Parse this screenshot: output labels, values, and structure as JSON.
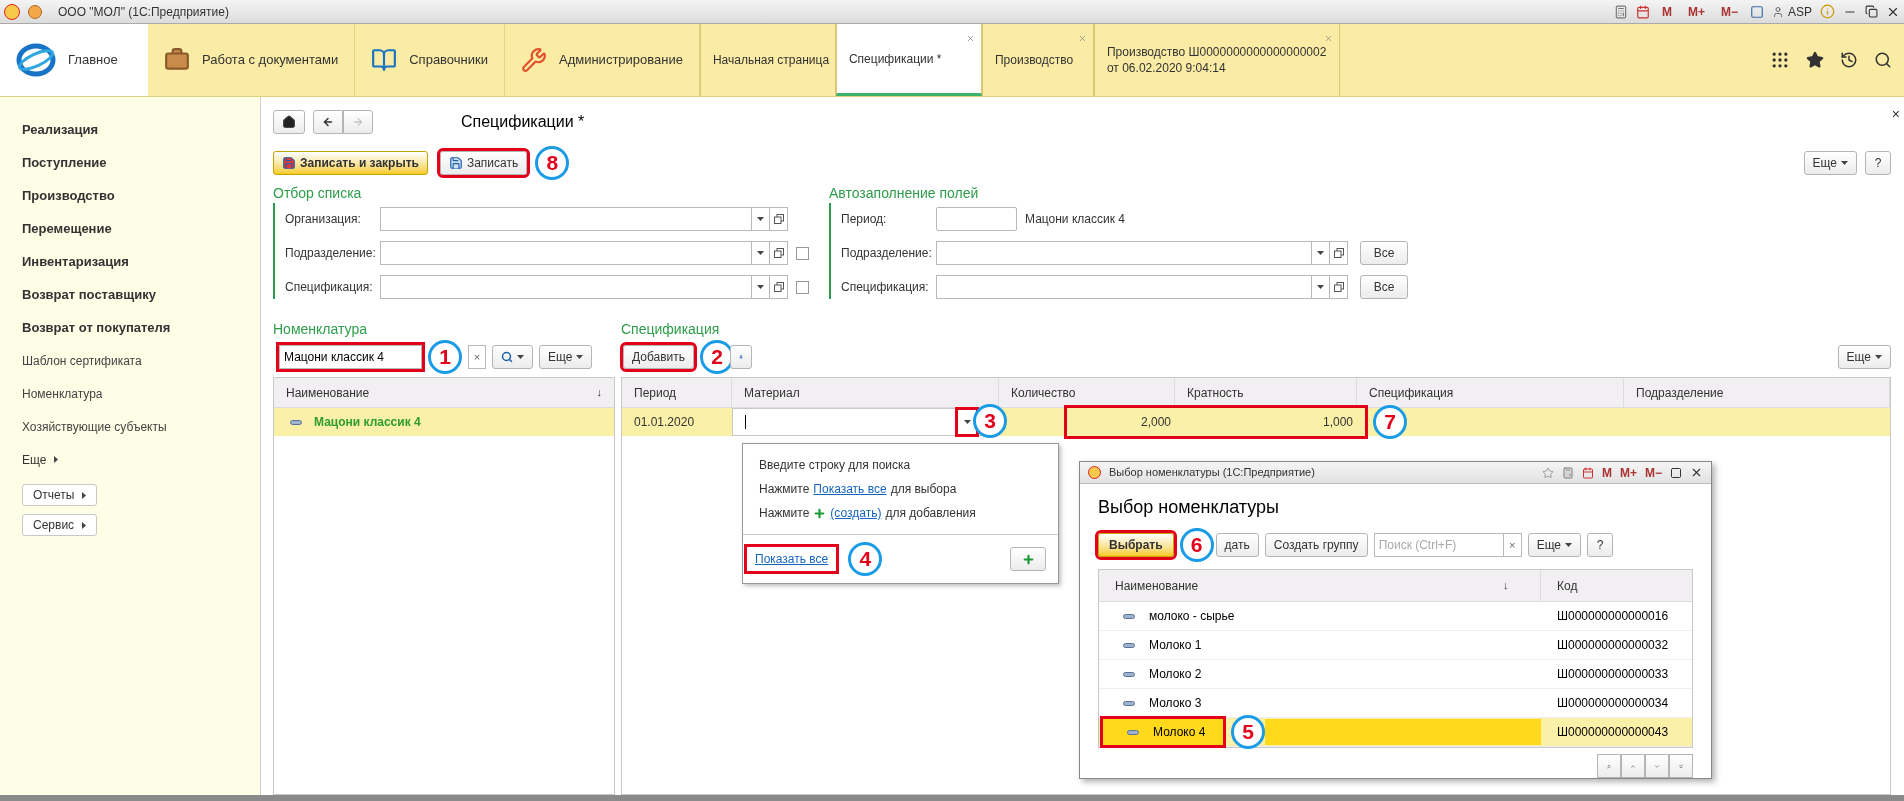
{
  "window": {
    "title": "ООО \"МОЛ\" (1С:Предприятие)",
    "memory_buttons": [
      "M",
      "M+",
      "M−"
    ],
    "user": "ASP"
  },
  "sections": [
    {
      "label": "Главное",
      "kind": "home",
      "selected": true
    },
    {
      "label": "Работа с документами",
      "kind": "briefcase",
      "selected": false
    },
    {
      "label": "Справочники",
      "kind": "book",
      "selected": false
    },
    {
      "label": "Администрирование",
      "kind": "tools",
      "selected": false
    }
  ],
  "open_tabs": [
    {
      "label": "Начальная страница",
      "selected": false,
      "closable": false
    },
    {
      "label": "Спецификации *",
      "selected": true,
      "closable": true
    },
    {
      "label": "Производство",
      "selected": false,
      "closable": true
    },
    {
      "label": "Производство Ш0000000000000000002 от 06.02.2020 9:04:14",
      "selected": false,
      "closable": true
    }
  ],
  "sidebar": {
    "items": [
      {
        "label": "Реализация",
        "kind": "section"
      },
      {
        "label": "Поступление",
        "kind": "section"
      },
      {
        "label": "Производство",
        "kind": "section"
      },
      {
        "label": "Перемещение",
        "kind": "section"
      },
      {
        "label": "Инвентаризация",
        "kind": "section"
      },
      {
        "label": "Возврат поставщику",
        "kind": "section"
      },
      {
        "label": "Возврат от покупателя",
        "kind": "section"
      },
      {
        "label": "Шаблон сертификата",
        "kind": "link"
      },
      {
        "label": "Номенклатура",
        "kind": "link"
      },
      {
        "label": "Хозяйствующие субъекты",
        "kind": "link"
      },
      {
        "label": "Еще",
        "kind": "more"
      },
      {
        "label": "Отчеты",
        "kind": "button"
      },
      {
        "label": "Сервис",
        "kind": "button"
      }
    ]
  },
  "form": {
    "title": "Спецификации *",
    "close": "×",
    "buttons": [
      {
        "label": "Записать и закрыть",
        "kind": "primary"
      },
      {
        "label": "Записать",
        "kind": "default",
        "annotation": "8"
      }
    ],
    "more": "Еще",
    "help": "?"
  },
  "filter": {
    "title": "Отбор списка",
    "fields": [
      {
        "label": "Организация:"
      },
      {
        "label": "Подразделение:",
        "checked": false
      },
      {
        "label": "Спецификация:",
        "checked": false
      }
    ]
  },
  "autofill": {
    "title": "Автозаполнение полей",
    "period": {
      "label": "Период:",
      "note": "Мацони классик 4"
    },
    "fields": [
      {
        "label": "Подразделение:",
        "button": "Все"
      },
      {
        "label": "Спецификация:",
        "button": "Все"
      }
    ]
  },
  "nomenclature": {
    "title": "Номенклатура",
    "search": {
      "value": "Мацони классик 4",
      "annotation": "1"
    },
    "clear": "×",
    "more": "Еще",
    "column": "Наименование",
    "sort_mark": "↓",
    "rows": [
      {
        "name": "Мацони классик 4",
        "selected": true
      }
    ]
  },
  "specification": {
    "title": "Спецификация",
    "add": {
      "label": "Добавить",
      "annotation": "2"
    },
    "more": "Еще",
    "columns": [
      "Период",
      "Материал",
      "Количество",
      "Кратность",
      "Спецификация",
      "Подразделение"
    ],
    "rows": [
      {
        "period": "01.01.2020",
        "quantity": "2,000",
        "multiplicity": "1,000",
        "selected": true,
        "dropdown_annotation": "3",
        "numbers_annotation": "7"
      }
    ]
  },
  "dropdown": {
    "hint": "Введите строку для поиска",
    "lines": [
      {
        "before": "Нажмите",
        "link": "Показать все",
        "after": "для выбора",
        "kind": "text"
      },
      {
        "before": "Нажмите",
        "link": "(создать)",
        "after": "для добавления",
        "kind": "plus"
      }
    ],
    "show_all": {
      "label": "Показать все",
      "annotation": "4"
    }
  },
  "dialog": {
    "title": "Выбор номенклатуры (1С:Предприятие)",
    "memory_buttons": [
      "M",
      "M+",
      "M−"
    ],
    "heading": "Выбор номенклатуры",
    "choose": {
      "label": "Выбрать",
      "annotation": "6"
    },
    "create": "дать",
    "create_group": "Создать группу",
    "search": {
      "placeholder": "Поиск (Ctrl+F)"
    },
    "clear": "×",
    "more": "Еще",
    "help": "?",
    "columns": [
      "Наименование",
      "Код"
    ],
    "sort_mark": "↓",
    "rows": [
      {
        "name": "молоко - сырье",
        "code": "Ш000000000000016",
        "selected": false
      },
      {
        "name": "Молоко 1",
        "code": "Ш000000000000032",
        "selected": false
      },
      {
        "name": "Молоко 2",
        "code": "Ш000000000000033",
        "selected": false
      },
      {
        "name": "Молоко 3",
        "code": "Ш000000000000034",
        "selected": false
      },
      {
        "name": "Молоко 4",
        "code": "Ш000000000000043",
        "selected": true,
        "annotation": "5"
      }
    ]
  }
}
